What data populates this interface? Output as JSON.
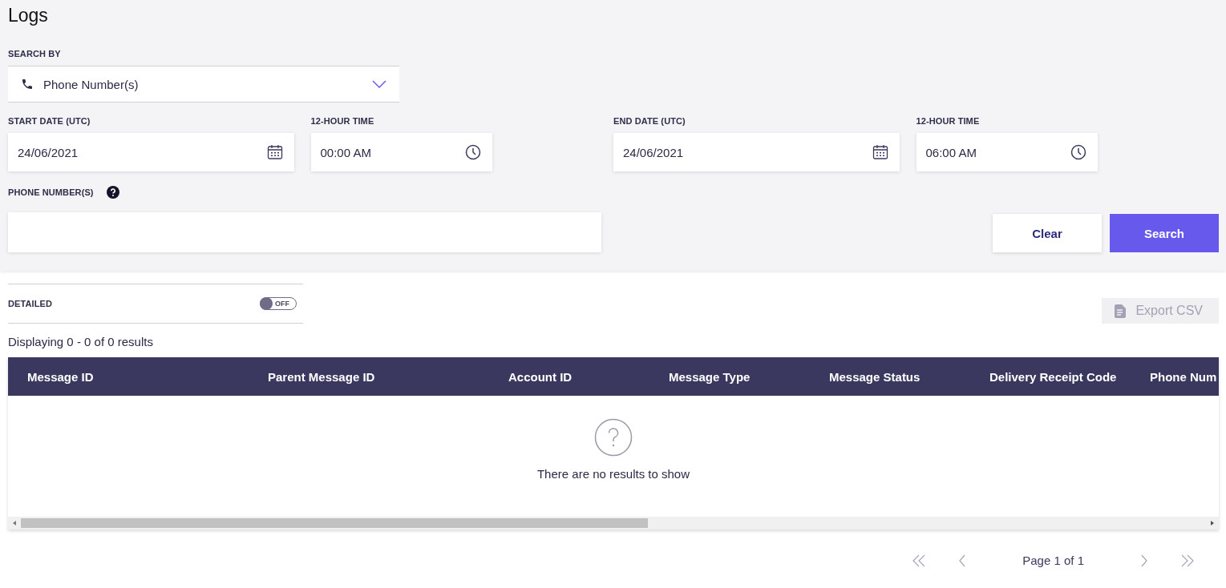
{
  "title": "Logs",
  "search_by": {
    "label": "SEARCH BY",
    "value": "Phone Number(s)"
  },
  "date_fields": [
    {
      "label": "START DATE (UTC)",
      "value": "24/06/2021",
      "kind": "date"
    },
    {
      "label": "12-HOUR TIME",
      "value": "00:00 AM",
      "kind": "time"
    },
    {
      "label": "END DATE (UTC)",
      "value": "24/06/2021",
      "kind": "date"
    },
    {
      "label": "12-HOUR TIME",
      "value": "06:00 AM",
      "kind": "time"
    }
  ],
  "phone_numbers": {
    "label": "PHONE NUMBER(S)"
  },
  "buttons": [
    {
      "label": "Clear",
      "kind": "secondary"
    },
    {
      "label": "Search",
      "kind": "primary"
    }
  ],
  "detailed": {
    "label": "DETAILED",
    "on": false,
    "state_text": "OFF"
  },
  "export_button": {
    "label": "Export CSV",
    "disabled": true
  },
  "results_summary": "Displaying 0 - 0 of 0 results",
  "table": {
    "columns": [
      {
        "label": "Message ID",
        "kind": "wide"
      },
      {
        "label": "Parent Message ID",
        "kind": "wide"
      },
      {
        "label": "Account ID",
        "kind": "normal"
      },
      {
        "label": "Message Type",
        "kind": "normal"
      },
      {
        "label": "Message Status",
        "kind": "normal"
      },
      {
        "label": "Delivery Receipt Code",
        "kind": "normal"
      },
      {
        "label": "Phone Num",
        "kind": "cut"
      }
    ],
    "empty_message": "There are no results to show"
  },
  "pagination": {
    "page_text": "Page 1 of 1"
  }
}
